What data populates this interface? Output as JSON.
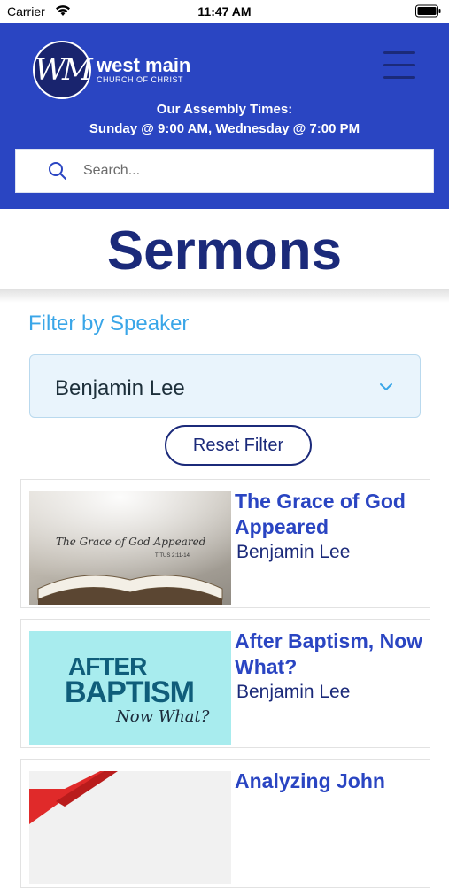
{
  "status": {
    "carrier": "Carrier",
    "time": "11:47 AM"
  },
  "header": {
    "logo_mark": "WM",
    "logo_name": "west main",
    "logo_sub": "CHURCH OF CHRIST",
    "assembly_title": "Our Assembly Times:",
    "assembly_times": "Sunday @ 9:00 AM,  Wednesday @ 7:00 PM",
    "search_placeholder": "Search..."
  },
  "page_title": "Sermons",
  "filter": {
    "label": "Filter by Speaker",
    "selected": "Benjamin Lee",
    "reset_label": "Reset Filter"
  },
  "sermons": [
    {
      "title": "The Grace of God Appeared",
      "speaker": "Benjamin Lee",
      "thumb_text": "The Grace of God Appeared",
      "thumb_ref": "TITUS 2:11-14"
    },
    {
      "title": "After Baptism, Now What?",
      "speaker": "Benjamin Lee",
      "thumb_line1": "AFTER",
      "thumb_line2": "BAPTISM",
      "thumb_line3": "Now What?"
    },
    {
      "title": "Analyzing John",
      "speaker": ""
    }
  ],
  "colors": {
    "brand_blue": "#2a45c2",
    "navy": "#1b2a7a",
    "accent": "#3aa6e8"
  }
}
